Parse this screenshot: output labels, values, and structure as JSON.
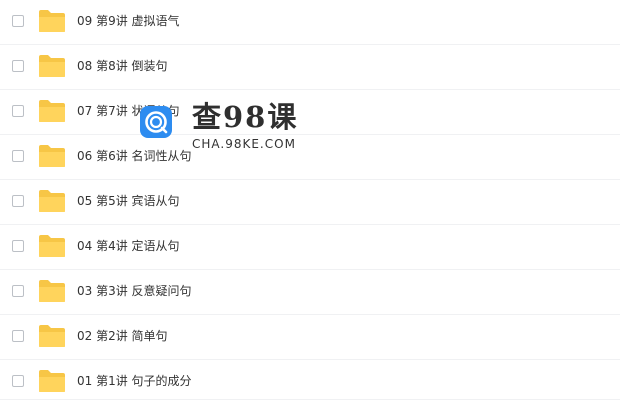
{
  "folder_color": "#F7C646",
  "folders": [
    {
      "name": "09 第9讲 虚拟语气"
    },
    {
      "name": "08 第8讲 倒装句"
    },
    {
      "name": "07 第7讲 状语从句"
    },
    {
      "name": "06 第6讲 名词性从句"
    },
    {
      "name": "05 第5讲 宾语从句"
    },
    {
      "name": "04 第4讲 定语从句"
    },
    {
      "name": "03 第3讲 反意疑问句"
    },
    {
      "name": "02 第2讲 简单句"
    },
    {
      "name": "01 第1讲 句子的成分"
    }
  ],
  "watermark": {
    "title": "查98课",
    "subtitle": "CHA.98KE.COM",
    "color": "#2D8CF0"
  }
}
